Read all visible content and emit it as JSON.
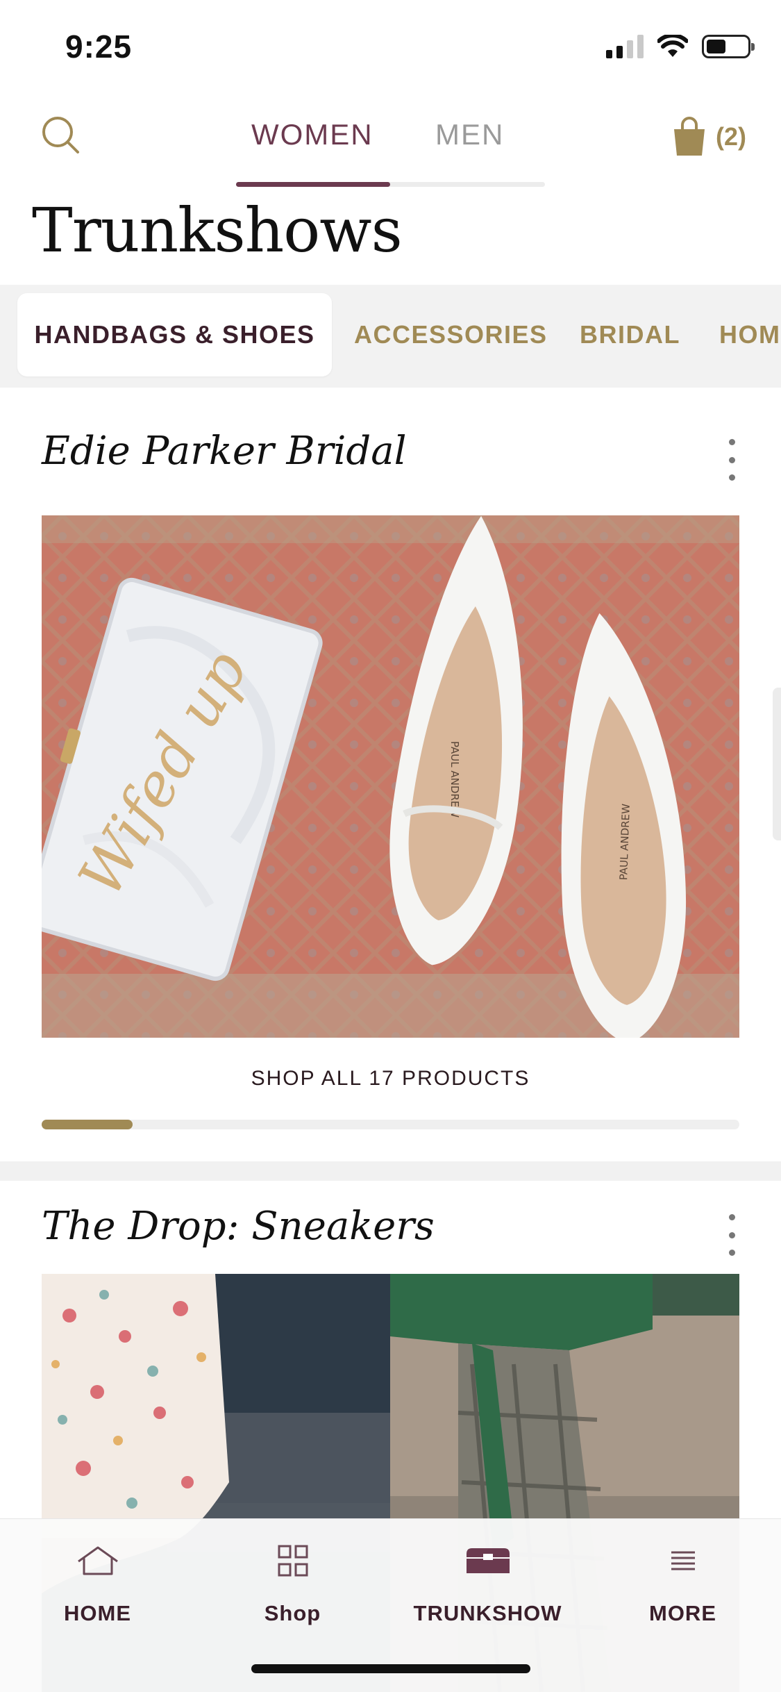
{
  "status_bar": {
    "time": "9:25"
  },
  "header": {
    "tabs": [
      {
        "label": "WOMEN",
        "active": true
      },
      {
        "label": "MEN",
        "active": false
      }
    ],
    "cart_count": "(2)",
    "title": "Trunkshows"
  },
  "categories": [
    {
      "label": "HANDBAGS & SHOES",
      "active": true
    },
    {
      "label": "ACCESSORIES",
      "active": false
    },
    {
      "label": "BRIDAL",
      "active": false
    },
    {
      "label": "HOM",
      "active": false
    }
  ],
  "trunkshows": [
    {
      "title": "Edie Parker Bridal",
      "image_text": "Wifed up",
      "shoe_brand": "PAUL ANDREW",
      "shop_all_label": "SHOP ALL 17 PRODUCTS",
      "carousel_progress": 0.13
    },
    {
      "title": "The Drop: Sneakers"
    }
  ],
  "tab_bar": [
    {
      "label": "HOME",
      "icon": "home-icon"
    },
    {
      "label": "Shop",
      "icon": "grid-icon"
    },
    {
      "label": "TRUNKSHOW",
      "icon": "trunk-icon"
    },
    {
      "label": "MORE",
      "icon": "menu-icon"
    }
  ],
  "colors": {
    "accent_gold": "#a08a55",
    "accent_plum": "#6b3a4f",
    "dark_text": "#2a1a1f"
  }
}
